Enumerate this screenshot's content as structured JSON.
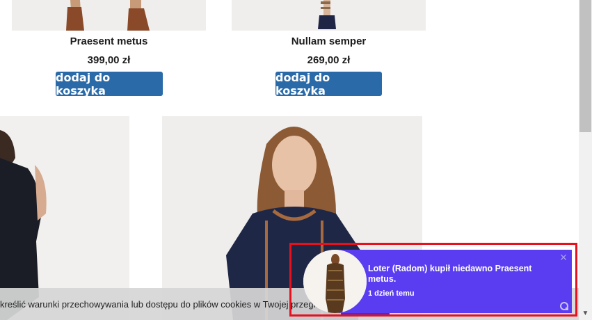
{
  "products": [
    {
      "name": "Praesent metus",
      "price": "399,00 zł",
      "button": "dodaj do koszyka"
    },
    {
      "name": "Nullam semper",
      "price": "269,00 zł",
      "button": "dodaj do koszyka"
    }
  ],
  "cookie_bar": {
    "text": "kreślić warunki przechowywania lub dostępu do plików cookies w Twojej przeglą"
  },
  "notification": {
    "message": "Loter (Radom) kupił niedawno Praesent metus.",
    "time": "1 dzień temu",
    "accent_color": "#5a3df0",
    "highlight_color": "#e8101c"
  },
  "icons": {
    "close": "close-icon",
    "logo": "notification-logo-icon",
    "scroll_down": "chevron-down-icon"
  },
  "colors": {
    "button_bg": "#2a6aa8"
  }
}
